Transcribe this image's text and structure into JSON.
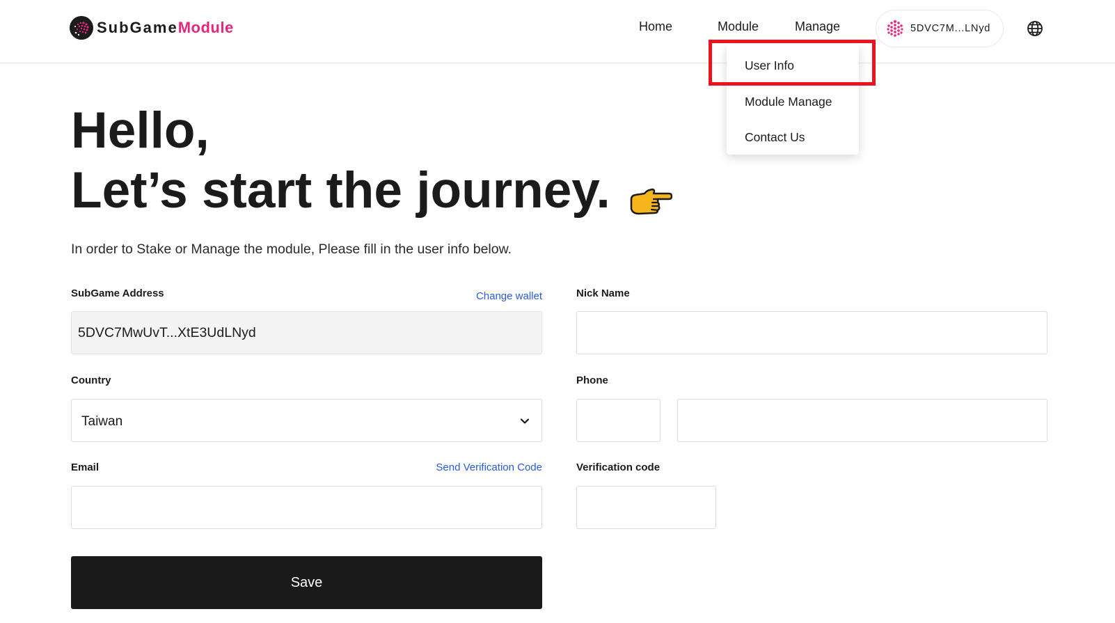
{
  "header": {
    "logo": {
      "sub": "SubGame",
      "module": "Module"
    },
    "nav": {
      "home": "Home",
      "module": "Module",
      "manage": "Manage"
    },
    "wallet_label": "5DVC7M...LNyd",
    "icons": {
      "wallet": "subgame-token-icon",
      "language": "globe-icon"
    }
  },
  "dropdown": {
    "items": [
      "User Info",
      "Module Manage",
      "Contact Us"
    ],
    "highlight_color": "#e8141f"
  },
  "hero": {
    "line1": "Hello,",
    "line2": "Let’s start the journey.",
    "icon": "pointing-hand-icon"
  },
  "intro": "In order to Stake or Manage the module, Please fill in the user info below.",
  "form": {
    "address": {
      "label": "SubGame Address",
      "link": "Change wallet",
      "value": "5DVC7MwUvT...XtE3UdLNyd"
    },
    "nickname": {
      "label": "Nick Name",
      "value": ""
    },
    "country": {
      "label": "Country",
      "value": "Taiwan"
    },
    "phone": {
      "label": "Phone",
      "code": "",
      "number": ""
    },
    "email": {
      "label": "Email",
      "link": "Send Verification Code",
      "value": ""
    },
    "verification": {
      "label": "Verification code",
      "value": ""
    },
    "save_label": "Save"
  },
  "colors": {
    "brand_pink": "#e6267d",
    "link_blue": "#2a5bd7",
    "button_dark": "#1a1a1a"
  }
}
